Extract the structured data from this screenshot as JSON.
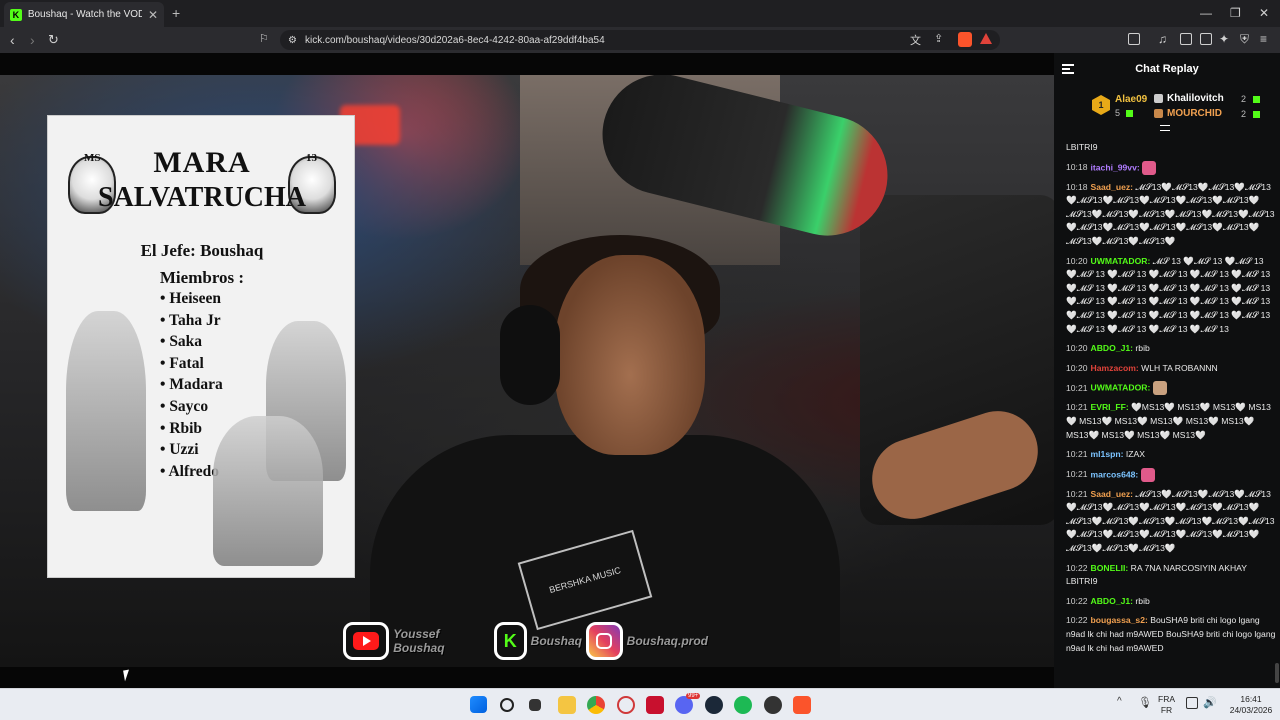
{
  "browser": {
    "tab_title": "Boushaq - Watch the VOD on",
    "tab_favicon": "K",
    "url": "kick.com/boushaq/videos/30d202a6-8ec4-4242-80aa-af29ddf4ba54",
    "new_tab": "+",
    "close_tab": "✕"
  },
  "poster": {
    "title_line1": "MARA",
    "title_line2": "SALVATRUCHA",
    "tag_left": "MS",
    "tag_right": "13",
    "jefe": "El Jefe: Boushaq",
    "miembros_heading": "Miembros :",
    "members": [
      "Heiseen",
      "Taha Jr",
      "Saka",
      "Fatal",
      "Madara",
      "Sayco",
      "Rbib",
      "Uzzi",
      "Alfredo"
    ],
    "shirt_text": "BERSHKA MUSIC"
  },
  "socials": {
    "youtube": "Youssef Boushaq",
    "kick": "Boushaq",
    "instagram": "Boushaq.prod",
    "kick_logo": "K"
  },
  "chat": {
    "title": "Chat Replay",
    "leaderboard": {
      "first": {
        "name": "Alae09",
        "count": "5",
        "rank": "1"
      },
      "second": {
        "name": "Khalilovitch",
        "count": "2"
      },
      "third": {
        "name": "MOURCHID",
        "count": "2"
      }
    },
    "top_fragment": "LBITRI9",
    "messages": [
      {
        "time": "10:18",
        "user": "itachi_99vv:",
        "color": "#b07cff",
        "text": "",
        "emote": "#e05a8a"
      },
      {
        "time": "10:18",
        "user": "Saad_uez:",
        "color": "#f0a050",
        "text": "𝓜𝓢13🤍𝓜𝓢13🤍𝓜𝓢13🤍𝓜𝓢13🤍𝓜𝓢13🤍𝓜𝓢13🤍𝓜𝓢13🤍𝓜𝓢13🤍𝓜𝓢13🤍𝓜𝓢13🤍𝓜𝓢13🤍𝓜𝓢13🤍𝓜𝓢13🤍𝓜𝓢13🤍𝓜𝓢13🤍𝓜𝓢13🤍𝓜𝓢13🤍𝓜𝓢13🤍𝓜𝓢13🤍𝓜𝓢13🤍𝓜𝓢13🤍𝓜𝓢13🤍𝓜𝓢13🤍",
        "emote": ""
      },
      {
        "time": "10:20",
        "user": "UWMATADOR:",
        "color": "#53fc18",
        "text": "𝓜𝓢 13 🤍𝓜𝓢 13 🤍𝓜𝓢 13 🤍𝓜𝓢 13 🤍𝓜𝓢 13 🤍𝓜𝓢 13 🤍𝓜𝓢 13 🤍𝓜𝓢 13 🤍𝓜𝓢 13 🤍𝓜𝓢 13 🤍𝓜𝓢 13 🤍𝓜𝓢 13 🤍𝓜𝓢 13 🤍𝓜𝓢 13 🤍𝓜𝓢 13 🤍𝓜𝓢 13 🤍𝓜𝓢 13 🤍𝓜𝓢 13 🤍𝓜𝓢 13 🤍𝓜𝓢 13 🤍𝓜𝓢 13 🤍𝓜𝓢 13 🤍𝓜𝓢 13 🤍𝓜𝓢 13 🤍𝓜𝓢 13 🤍𝓜𝓢 13 🤍𝓜𝓢 13",
        "emote": ""
      },
      {
        "time": "10:20",
        "user": "ABDO_J1:",
        "color": "#53fc18",
        "text": "rbib",
        "emote": ""
      },
      {
        "time": "10:20",
        "user": "Hamzacom:",
        "color": "#e0433a",
        "text": "WLH TA ROBANNN",
        "emote": ""
      },
      {
        "time": "10:21",
        "user": "UWMATADOR:",
        "color": "#53fc18",
        "text": "",
        "emote": "#c9a17f"
      },
      {
        "time": "10:21",
        "user": "EVRI_FF:",
        "color": "#53fc18",
        "text": "🤍MS13🤍 MS13🤍 MS13🤍 MS13🤍 MS13🤍 MS13🤍 MS13🤍 MS13🤍 MS13🤍 MS13🤍 MS13🤍 MS13🤍 MS13🤍",
        "emote": ""
      },
      {
        "time": "10:21",
        "user": "ml1spn:",
        "color": "#7cc4ff",
        "text": "IZAX",
        "emote": ""
      },
      {
        "time": "10:21",
        "user": "marcos648:",
        "color": "#7cc4ff",
        "text": "",
        "emote": "#e05a8a"
      },
      {
        "time": "10:21",
        "user": "Saad_uez:",
        "color": "#f0a050",
        "text": "𝓜𝓢13🤍𝓜𝓢13🤍𝓜𝓢13🤍𝓜𝓢13🤍𝓜𝓢13🤍𝓜𝓢13🤍𝓜𝓢13🤍𝓜𝓢13🤍𝓜𝓢13🤍𝓜𝓢13🤍𝓜𝓢13🤍𝓜𝓢13🤍𝓜𝓢13🤍𝓜𝓢13🤍𝓜𝓢13🤍𝓜𝓢13🤍𝓜𝓢13🤍𝓜𝓢13🤍𝓜𝓢13🤍𝓜𝓢13🤍𝓜𝓢13🤍𝓜𝓢13🤍𝓜𝓢13🤍",
        "emote": ""
      },
      {
        "time": "10:22",
        "user": "BONELII:",
        "color": "#53fc18",
        "text": "RA 7NA NARCOSIYIN AKHAY LBITRI9",
        "emote": ""
      },
      {
        "time": "10:22",
        "user": "ABDO_J1:",
        "color": "#53fc18",
        "text": "rbib",
        "emote": ""
      },
      {
        "time": "10:22",
        "user": "bougassa_s2:",
        "color": "#f0a050",
        "text": "BouSHA9 briti chi logo lgang n9ad lk chi had m9AWED BouSHA9 briti chi logo lgang n9ad lk chi had m9AWED",
        "emote": ""
      }
    ]
  },
  "taskbar": {
    "lang_top": "FRA",
    "lang_bottom": "FR",
    "time": "16:41",
    "date": "24/03/2026",
    "badge": "99+"
  },
  "colors": {
    "kick_green": "#53fc18",
    "chat_bg": "#0e0f10",
    "taskbar_bg": "#e9ecf2"
  }
}
